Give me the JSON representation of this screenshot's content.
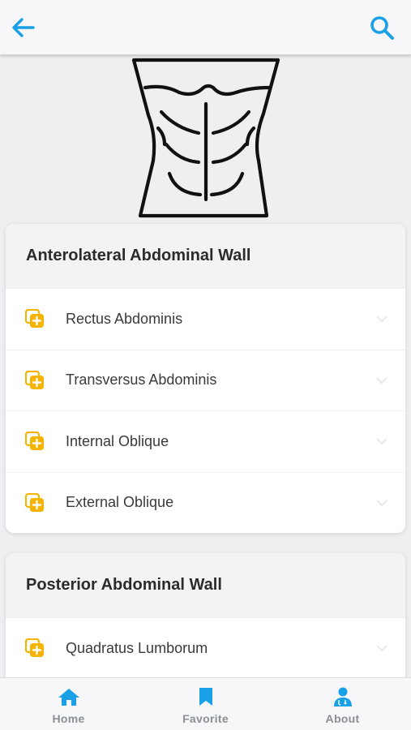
{
  "header": {
    "back_icon": "arrow-left-icon",
    "search_icon": "search-icon",
    "accent_color": "#1aa0e6"
  },
  "hero": {
    "image": "abdominal-muscles-illustration"
  },
  "sections": [
    {
      "title": "Anterolateral Abdominal Wall",
      "items": [
        {
          "label": "Rectus Abdominis",
          "icon": "add-to-collection-icon"
        },
        {
          "label": "Transversus Abdominis",
          "icon": "add-to-collection-icon"
        },
        {
          "label": "Internal Oblique",
          "icon": "add-to-collection-icon"
        },
        {
          "label": "External Oblique",
          "icon": "add-to-collection-icon"
        }
      ]
    },
    {
      "title": "Posterior Abdominal Wall",
      "items": [
        {
          "label": "Quadratus Lumborum",
          "icon": "add-to-collection-icon"
        }
      ]
    }
  ],
  "item_icon_color": "#f5b400",
  "bottom_nav": [
    {
      "label": "Home",
      "icon": "home-icon"
    },
    {
      "label": "Favorite",
      "icon": "bookmark-icon"
    },
    {
      "label": "About",
      "icon": "doctor-icon"
    }
  ]
}
